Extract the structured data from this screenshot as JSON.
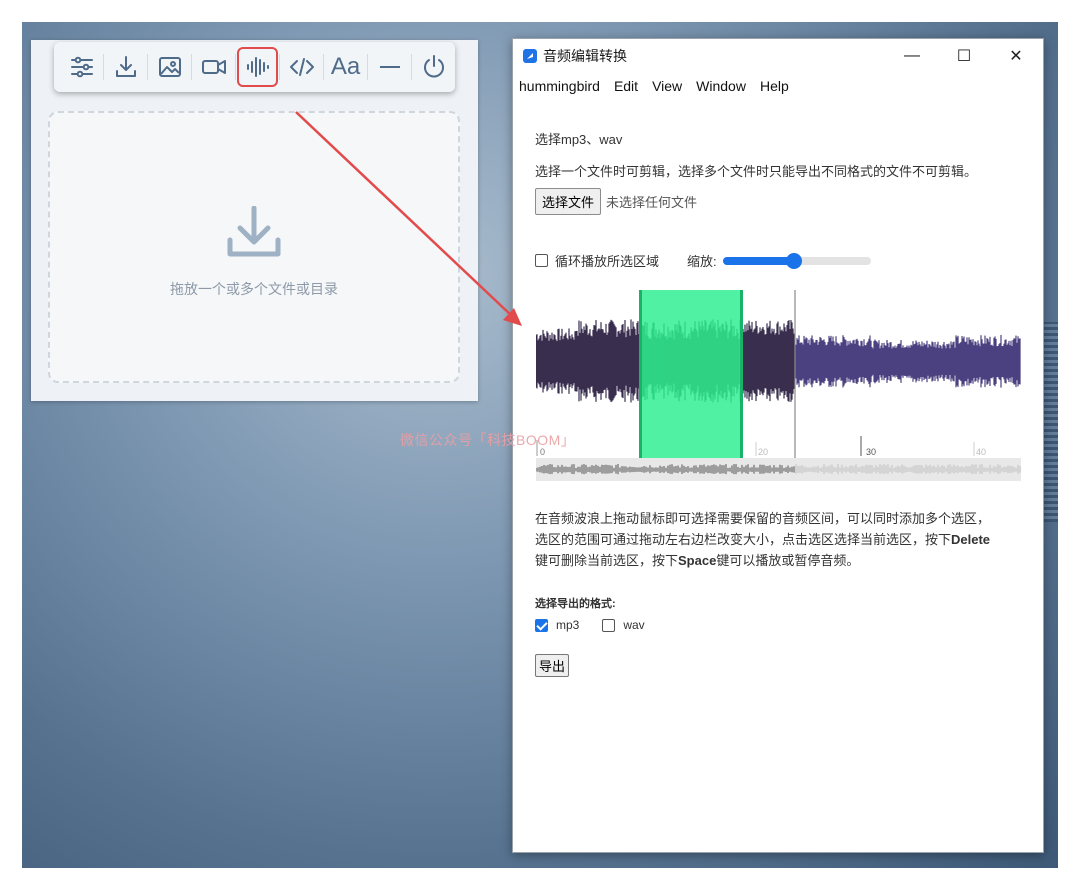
{
  "toolbar": {
    "icons": [
      "sliders-icon",
      "download-icon",
      "image-icon",
      "video-icon",
      "audio-wave-icon",
      "code-icon",
      "font-icon",
      "minimize-icon",
      "power-icon"
    ],
    "font_label": "Aa"
  },
  "dropzone": {
    "text": "拖放一个或多个文件或目录"
  },
  "watermark": "微信公众号「科技BOOM」",
  "window": {
    "title": "音频编辑转换",
    "menu": [
      "hummingbird",
      "Edit",
      "View",
      "Window",
      "Help"
    ],
    "controls": {
      "minimize": "—",
      "maximize": "☐",
      "close": "✕"
    }
  },
  "content": {
    "choose_label": "选择mp3、wav",
    "hint": "选择一个文件时可剪辑，选择多个文件时只能导出不同格式的文件不可剪辑。",
    "file_button": "选择文件",
    "no_file": "未选择任何文件",
    "loop_label": "循环播放所选区域",
    "zoom_label": "缩放:",
    "zoom_level": 0.48
  },
  "waveform": {
    "timeline_labels": [
      "0",
      "20",
      "30",
      "40"
    ],
    "selection_color": "#3ef09a",
    "played_color": "#3a2f4f",
    "unplayed_color": "#4b4080"
  },
  "description": {
    "line1": "在音频波浪上拖动鼠标即可选择需要保留的音频区间，可以同时添加多个选区，",
    "line2_a": "选区的范围可通过拖动左右边栏改变大小，点击选区选择当前选区，按下",
    "line2_b": "Delete",
    "line3_a": "键可删除当前选区，按下",
    "line3_b": "Space",
    "line3_c": "键可以播放或暂停音频。"
  },
  "format": {
    "title": "选择导出的格式:",
    "options": [
      {
        "label": "mp3",
        "checked": true
      },
      {
        "label": "wav",
        "checked": false
      }
    ],
    "export_button": "导出"
  },
  "colors": {
    "accent": "#1a73e8",
    "highlight_box": "#e24b4b",
    "arrow": "#e24b4b"
  }
}
